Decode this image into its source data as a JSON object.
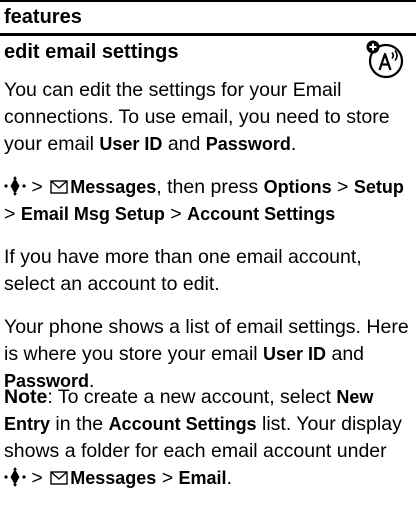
{
  "header": {
    "section": "features"
  },
  "page": {
    "title": "edit email settings"
  },
  "icons": {
    "connection": "network-connection-icon",
    "nav_key": "nav-key-icon",
    "mail": "envelope-icon"
  },
  "para1": {
    "text1": "You can edit the settings for your Email connections. To use email, you need to store your email ",
    "user_id": "User ID",
    "and": " and ",
    "password": "Password",
    "end": "."
  },
  "para2": {
    "gt1": " > ",
    "messages": "Messages",
    "then": ", then press ",
    "options": "Options",
    "gt2": " > ",
    "setup": "Setup",
    "gt3": " > ",
    "email_msg_setup": "Email Msg Setup",
    "gt4": " > ",
    "account_settings": "Account Settings"
  },
  "para3": {
    "text": "If you have more than one email account, select an account to edit."
  },
  "para4": {
    "text1": "Your phone shows a list of email settings. Here is where you store your email ",
    "user_id": "User ID",
    "and": " and ",
    "password": "Password",
    "end": "."
  },
  "para5": {
    "note": "Note",
    "text1": ": To create a new account, select ",
    "new_entry": "New Entry",
    "text2": " in the ",
    "account_settings": "Account Settings",
    "text3": " list. Your display shows a folder for each email account under ",
    "gt1": " > ",
    "messages": "Messages",
    "gt2": " > ",
    "email": "Email",
    "end": "."
  }
}
